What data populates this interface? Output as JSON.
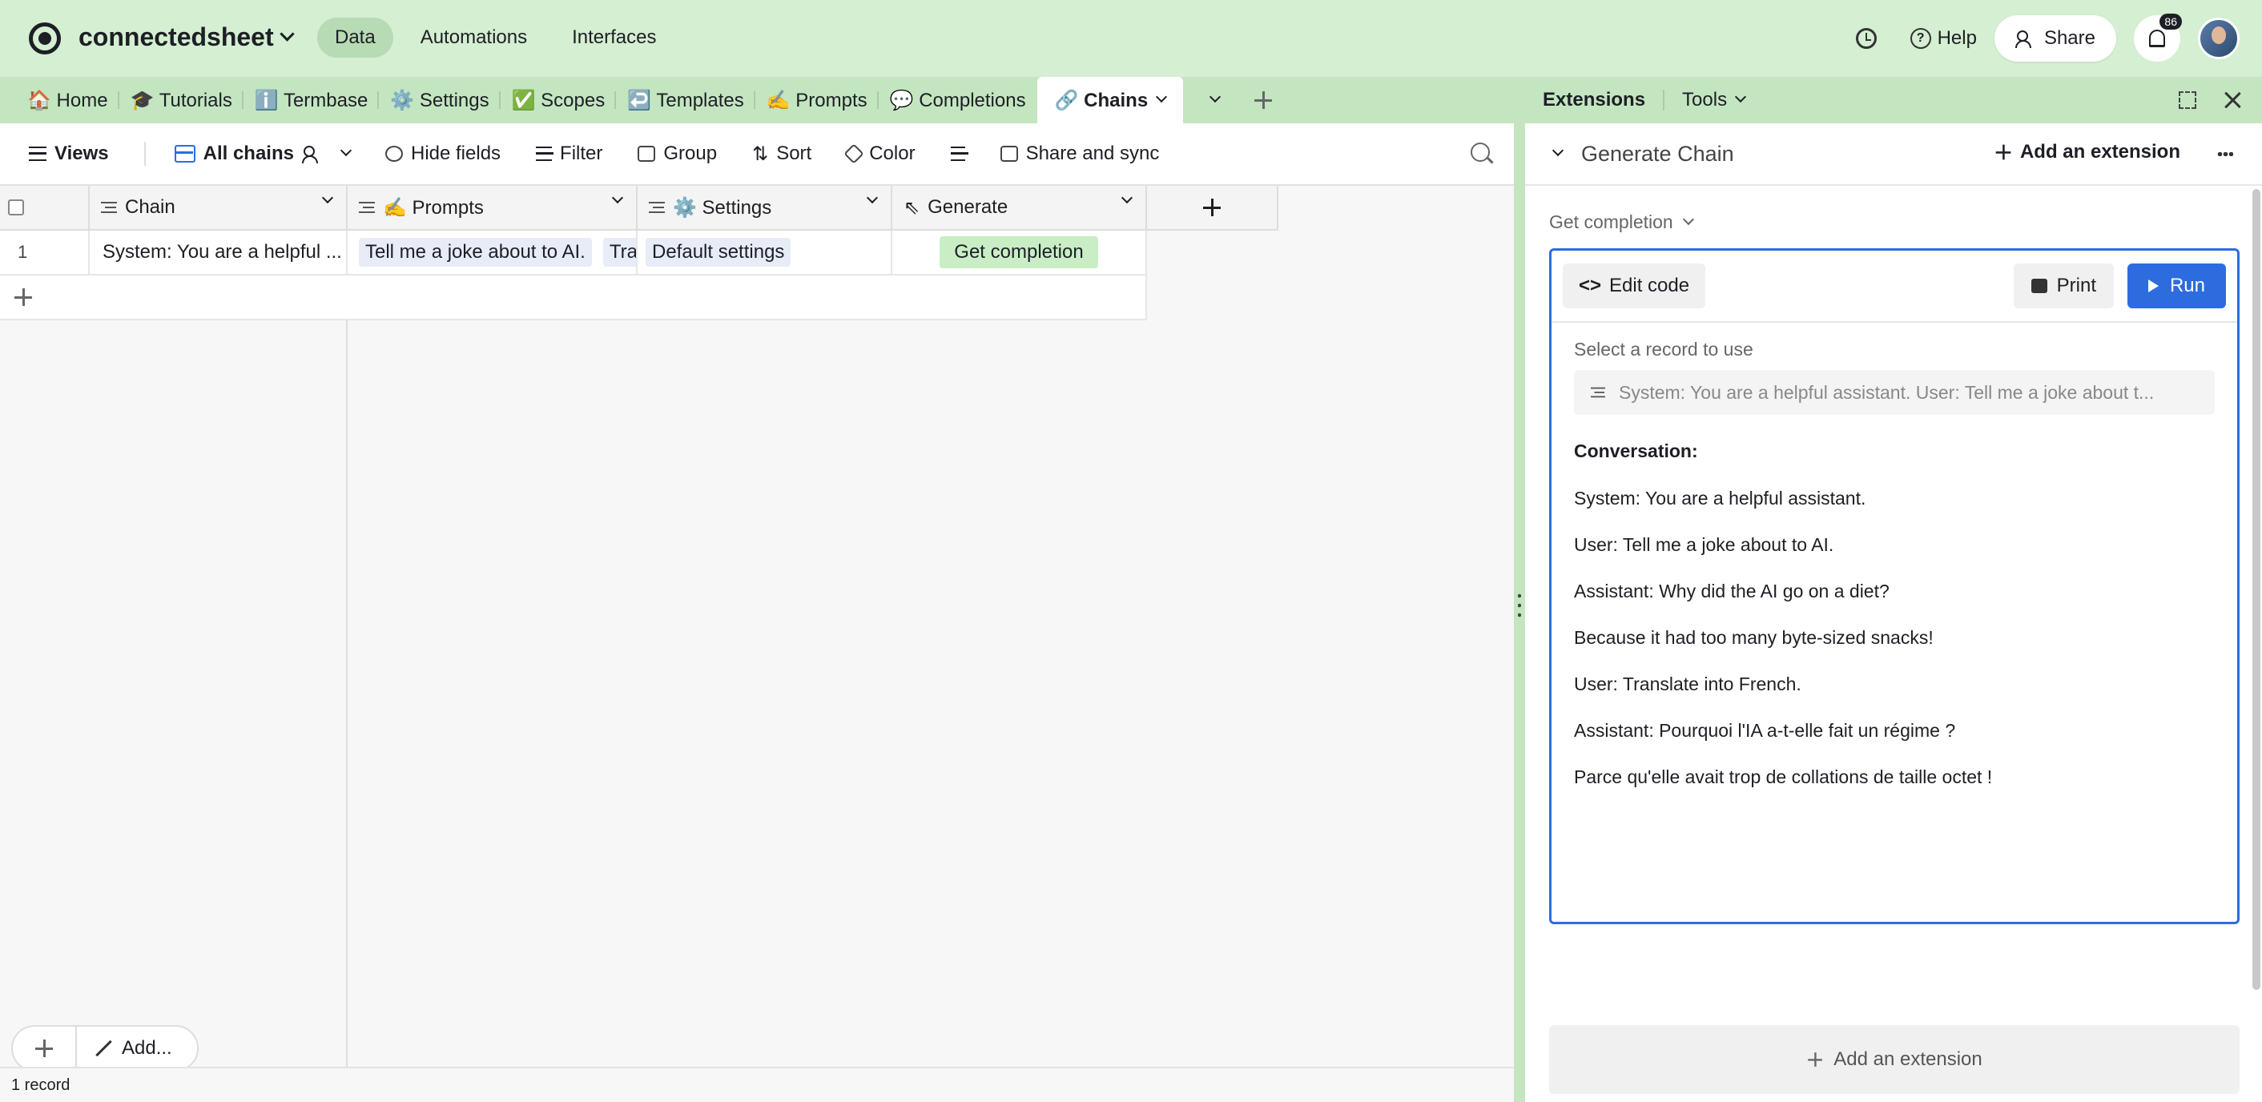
{
  "app": {
    "name": "connectedsheet"
  },
  "nav": {
    "data": "Data",
    "automations": "Automations",
    "interfaces": "Interfaces"
  },
  "topright": {
    "help": "Help",
    "share": "Share",
    "notifications": "86"
  },
  "tabs": [
    {
      "label": "🏠 Home"
    },
    {
      "label": "🎓 Tutorials"
    },
    {
      "label": "ℹ️ Termbase"
    },
    {
      "label": "⚙️ Settings"
    },
    {
      "label": "✅ Scopes"
    },
    {
      "label": "↩️ Templates"
    },
    {
      "label": "✍️ Prompts"
    },
    {
      "label": "💬 Completions"
    },
    {
      "label": "🔗 Chains"
    }
  ],
  "toolbar": {
    "views": "Views",
    "view_name": "All chains",
    "hide_fields": "Hide fields",
    "filter": "Filter",
    "group": "Group",
    "sort": "Sort",
    "color": "Color",
    "share_sync": "Share and sync"
  },
  "grid": {
    "columns": [
      "Chain",
      "✍️ Prompts",
      "⚙️ Settings",
      "Generate"
    ],
    "rows": [
      {
        "num": "1",
        "chain": "System: You are a helpful ...",
        "prompts": [
          "Tell me a joke about to AI.",
          "Trans"
        ],
        "settings": "Default settings",
        "generate": "Get completion"
      }
    ],
    "record_count": "1 record",
    "add_label": "Add..."
  },
  "panel": {
    "tab_extensions": "Extensions",
    "tab_tools": "Tools",
    "extension_title": "Generate Chain",
    "add_extension": "Add an extension",
    "action_select": "Get completion",
    "edit_code": "Edit code",
    "print": "Print",
    "run": "Run",
    "select_label": "Select a record to use",
    "selected_record": "System: You are a helpful assistant. User: Tell me a joke about t...",
    "conversation_title": "Conversation:",
    "conversation": [
      "System: You are a helpful assistant.",
      "User: Tell me a joke about to AI.",
      "Assistant: Why did the AI go on a diet?",
      "Because it had too many byte-sized snacks!",
      "User: Translate into French.",
      "Assistant: Pourquoi l'IA a-t-elle fait un régime ?",
      "Parce qu'elle avait trop de collations de taille octet !"
    ],
    "add_extension_bottom": "Add an extension"
  }
}
